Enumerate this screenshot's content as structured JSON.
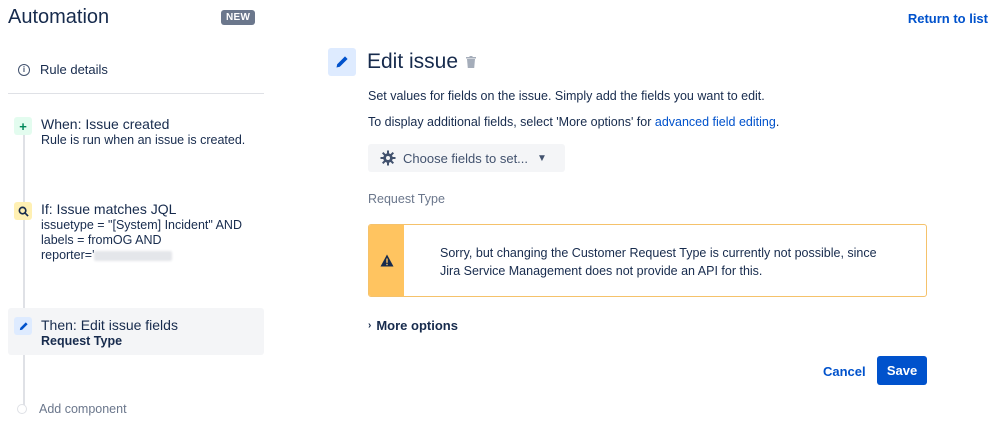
{
  "header": {
    "app_title": "Automation",
    "badge": "NEW",
    "return_link": "Return to list"
  },
  "sidebar": {
    "rule_details": "Rule details",
    "steps": [
      {
        "kind": "when",
        "icon": "plus-icon",
        "title": "When: Issue created",
        "desc": "Rule is run when an issue is created."
      },
      {
        "kind": "if",
        "icon": "search-icon",
        "title": "If: Issue matches JQL",
        "desc_lines": [
          "issuetype = \"[System] Incident\" AND",
          "labels = fromOG AND",
          "reporter='"
        ]
      },
      {
        "kind": "then",
        "icon": "pencil-icon",
        "title": "Then: Edit issue fields",
        "desc": "Request Type"
      }
    ],
    "add_component": "Add component"
  },
  "main": {
    "title": "Edit issue",
    "desc1": "Set values for fields on the issue. Simply add the fields you want to edit.",
    "desc2_prefix": "To display additional fields, select 'More options' for ",
    "desc2_link": "advanced field editing",
    "desc2_suffix": ".",
    "choose_fields": "Choose fields to set...",
    "request_type_label": "Request Type",
    "warning_line1": "Sorry, but changing the Customer Request Type is currently not possible, since",
    "warning_line2": "Jira Service Management does not provide an API for this.",
    "more_options": "More options",
    "cancel": "Cancel",
    "save": "Save"
  },
  "colors": {
    "accent": "#0052cc",
    "warning": "#ffc460",
    "when_icon_bg": "#e3fcef",
    "if_icon_bg": "#fff0b3",
    "then_icon_bg": "#deebff"
  }
}
